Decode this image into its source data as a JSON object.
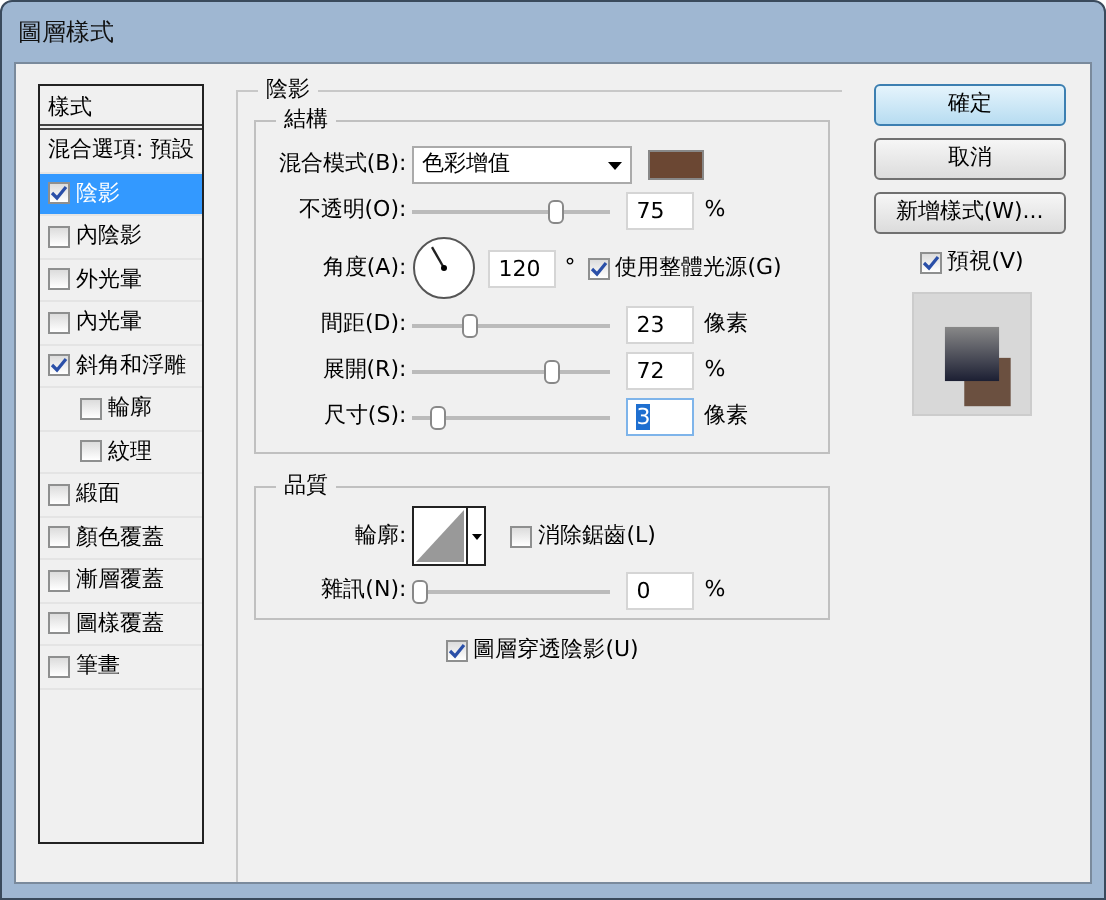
{
  "window": {
    "title": "圖層樣式"
  },
  "styles_panel": {
    "header": "樣式",
    "items": [
      {
        "label": "混合選項: 預設",
        "kind": "plain",
        "selected": false
      },
      {
        "label": "陰影",
        "kind": "check",
        "checked": true,
        "selected": true
      },
      {
        "label": "內陰影",
        "kind": "check",
        "checked": false,
        "selected": false
      },
      {
        "label": "外光暈",
        "kind": "check",
        "checked": false,
        "selected": false
      },
      {
        "label": "內光暈",
        "kind": "check",
        "checked": false,
        "selected": false
      },
      {
        "label": "斜角和浮雕",
        "kind": "check",
        "checked": true,
        "selected": false,
        "children": [
          {
            "label": "輪廓",
            "kind": "check",
            "checked": false,
            "selected": false
          },
          {
            "label": "紋理",
            "kind": "check",
            "checked": false,
            "selected": false
          }
        ]
      },
      {
        "label": "緞面",
        "kind": "check",
        "checked": false,
        "selected": false
      },
      {
        "label": "顏色覆蓋",
        "kind": "check",
        "checked": false,
        "selected": false
      },
      {
        "label": "漸層覆蓋",
        "kind": "check",
        "checked": false,
        "selected": false
      },
      {
        "label": "圖樣覆蓋",
        "kind": "check",
        "checked": false,
        "selected": false
      },
      {
        "label": "筆畫",
        "kind": "check",
        "checked": false,
        "selected": false
      }
    ]
  },
  "drop_shadow": {
    "title": "陰影",
    "structure": {
      "title": "結構",
      "rows": [
        {
          "kind": "select",
          "label": "混合模式(B):",
          "value": "色彩增值",
          "color": "#6b4733"
        },
        {
          "kind": "slider",
          "label": "不透明(O):",
          "level": 0.75,
          "value": "75",
          "unit": "%"
        },
        {
          "kind": "angle",
          "label": "角度(A):",
          "value": "120",
          "unit": "°",
          "option": {
            "label": "使用整體光源(G)",
            "checked": true
          }
        },
        {
          "kind": "slider",
          "label": "間距(D):",
          "level": 0.27,
          "value": "23",
          "unit": "像素"
        },
        {
          "kind": "slider",
          "label": "展開(R):",
          "level": 0.72,
          "value": "72",
          "unit": "%"
        },
        {
          "kind": "slider",
          "label": "尺寸(S):",
          "level": 0.1,
          "value": "3",
          "unit": "像素",
          "focused": true
        }
      ]
    },
    "quality": {
      "title": "品質",
      "rows": [
        {
          "kind": "contour",
          "label": "輪廓:",
          "option": {
            "label": "消除鋸齒(L)",
            "checked": false
          }
        },
        {
          "kind": "slider",
          "label": "雜訊(N):",
          "level": 0,
          "value": "0",
          "unit": "%"
        }
      ]
    },
    "knockout": {
      "label": "圖層穿透陰影(U)",
      "checked": true
    }
  },
  "buttons": [
    {
      "label": "確定",
      "kind": "default"
    },
    {
      "label": "取消",
      "kind": "normal"
    },
    {
      "label": "新增樣式(W)...",
      "kind": "normal"
    }
  ],
  "preview": {
    "label": "預視(V)",
    "checked": true
  }
}
